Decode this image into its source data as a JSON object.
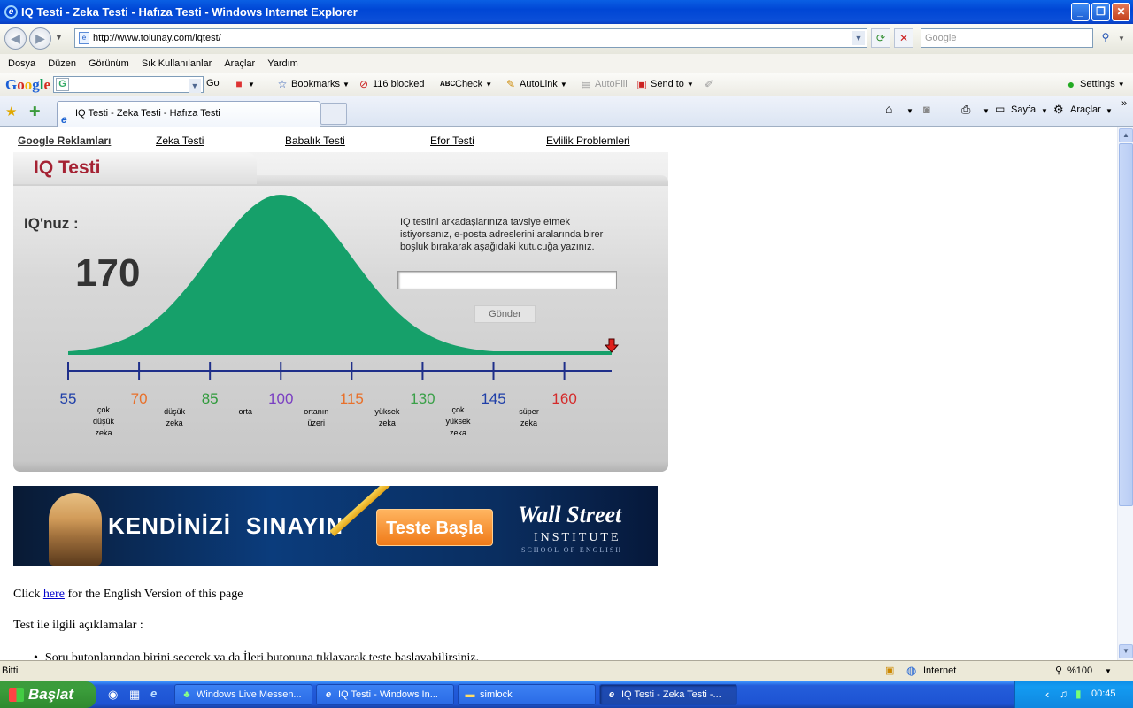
{
  "window": {
    "title": "IQ Testi - Zeka Testi - Hafıza Testi - Windows Internet Explorer"
  },
  "address": {
    "url": "http://www.tolunay.com/iqtest/",
    "search_placeholder": "Google"
  },
  "menu": [
    "Dosya",
    "Düzen",
    "Görünüm",
    "Sık Kullanılanlar",
    "Araçlar",
    "Yardım"
  ],
  "google_toolbar": {
    "logo": "Google",
    "go": "Go",
    "bookmarks": "Bookmarks",
    "blocked": "116 blocked",
    "check": "Check",
    "autolink": "AutoLink",
    "autofill": "AutoFill",
    "sendto": "Send to",
    "settings": "Settings"
  },
  "tab": {
    "title": "IQ Testi - Zeka Testi - Hafıza Testi"
  },
  "tab_tools": {
    "page": "Sayfa",
    "tools": "Araçlar"
  },
  "page": {
    "top_links": [
      "Google Reklamları",
      "Zeka Testi",
      "Babalık Testi",
      "Efor Testi",
      "Evlilik Problemleri"
    ],
    "panel_title": "IQ Testi",
    "iq_label": "IQ'nuz :",
    "iq_value": "170",
    "recommend_line1": "IQ testini arkadaşlarınıza tavsiye etmek",
    "recommend_line2": "istiyorsanız, e-posta adreslerini aralarında birer",
    "recommend_line3": "boşluk bırakarak aşağıdaki kutucuğa yazınız.",
    "email_value": "",
    "send_button": "Gönder",
    "banner": {
      "left": "KENDİNİZİ",
      "right": "SINAYIN",
      "button": "Teste Başla",
      "brand1": "Wall Street",
      "brand2": "INSTITUTE",
      "brand3": "SCHOOL OF ENGLISH"
    },
    "english_pre": "Click ",
    "english_link": "here",
    "english_post": " for the English Version of this page",
    "explain_title": "Test ile ilgili açıklamalar :",
    "bullet1": "Soru butonlarından birini seçerek ya da İleri butonuna tıklayarak teste başlayabilirsiniz."
  },
  "chart_data": {
    "type": "area",
    "title": "",
    "x_ticks": [
      55,
      70,
      85,
      100,
      115,
      130,
      145,
      160
    ],
    "x_tick_colors": [
      "#1f3fa8",
      "#e8702a",
      "#2e9a3a",
      "#7a3fc2",
      "#e8702a",
      "#3aa048",
      "#1f3fa8",
      "#d42b2b"
    ],
    "xlim": [
      55,
      170
    ],
    "curve": {
      "mean": 100,
      "sd": 15,
      "color": "#16a06a"
    },
    "marker_at": 170,
    "categories": [
      {
        "lines": [
          "çok",
          "düşük",
          "zeka"
        ]
      },
      {
        "lines": [
          "düşük",
          "zeka"
        ]
      },
      {
        "lines": [
          "orta"
        ]
      },
      {
        "lines": [
          "ortanın",
          "üzeri"
        ]
      },
      {
        "lines": [
          "yüksek",
          "zeka"
        ]
      },
      {
        "lines": [
          "çok",
          "yüksek",
          "zeka"
        ]
      },
      {
        "lines": [
          "süper",
          "zeka"
        ]
      }
    ]
  },
  "status": {
    "text": "Bitti",
    "zone": "Internet",
    "zoom": "%100"
  },
  "taskbar": {
    "start": "Başlat",
    "tasks": [
      "Windows Live Messen...",
      "IQ Testi - Windows In...",
      "simlock",
      "IQ Testi - Zeka Testi -..."
    ],
    "lang": "TR",
    "clock": "00:45"
  }
}
